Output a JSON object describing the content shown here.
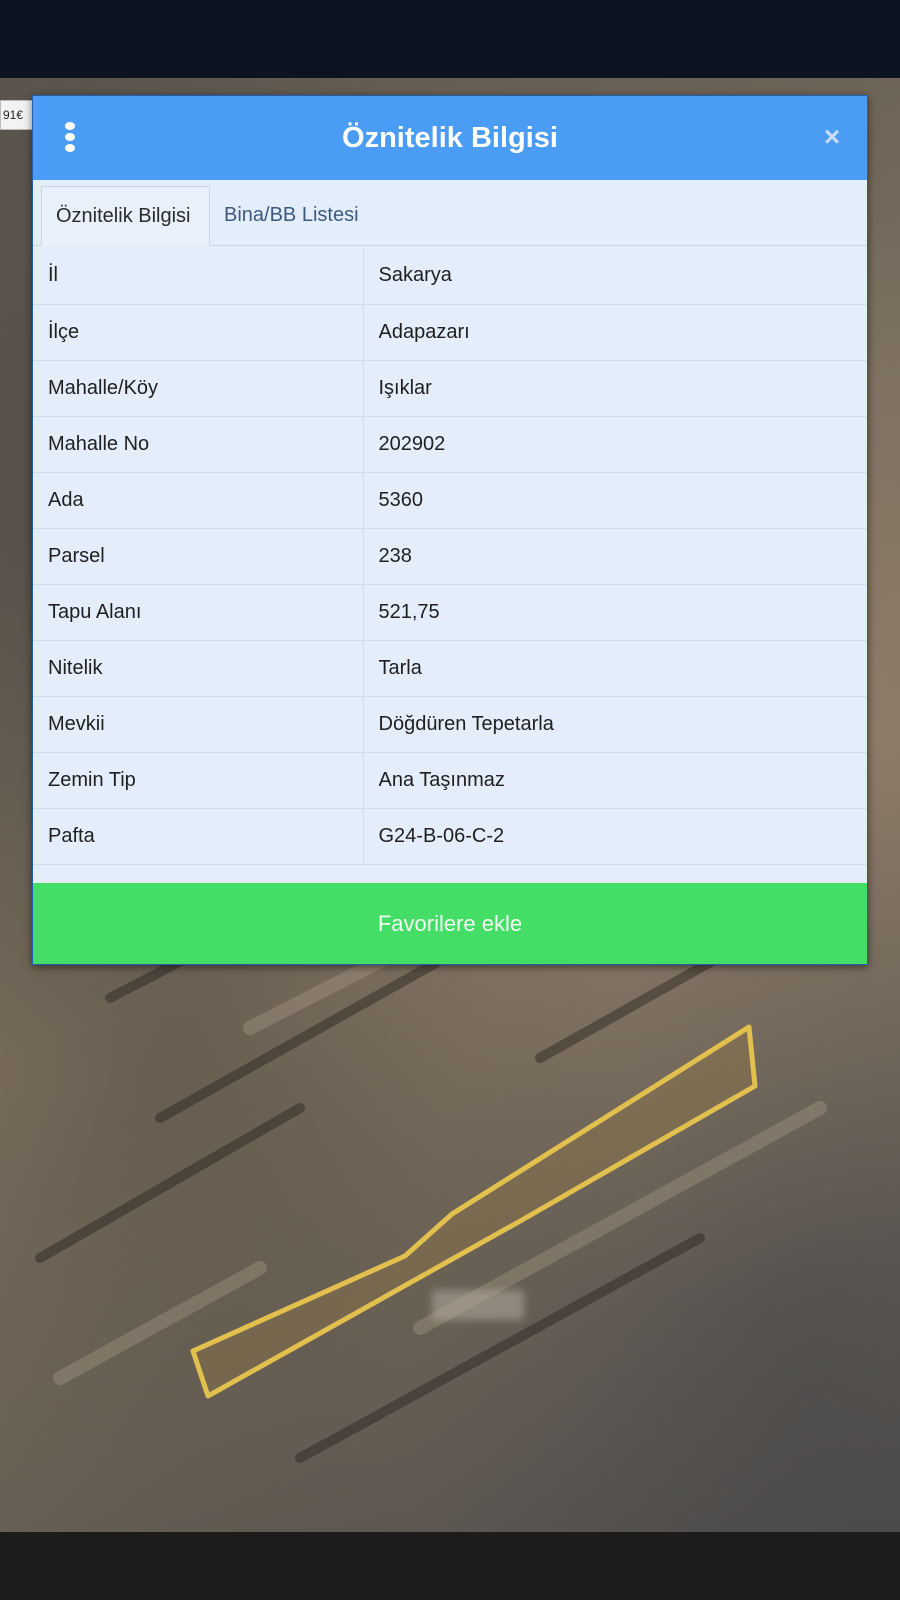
{
  "scale_chip_text": "91€",
  "dialog": {
    "title": "Öznitelik Bilgisi",
    "tabs": [
      {
        "label": "Öznitelik Bilgisi",
        "active": true
      },
      {
        "label": "Bina/BB Listesi",
        "active": false
      }
    ],
    "rows": [
      {
        "key": "İl",
        "value": "Sakarya"
      },
      {
        "key": "İlçe",
        "value": "Adapazarı"
      },
      {
        "key": "Mahalle/Köy",
        "value": "Işıklar"
      },
      {
        "key": "Mahalle No",
        "value": "202902"
      },
      {
        "key": "Ada",
        "value": "5360"
      },
      {
        "key": "Parsel",
        "value": "238"
      },
      {
        "key": "Tapu Alanı",
        "value": "521,75"
      },
      {
        "key": "Nitelik",
        "value": "Tarla"
      },
      {
        "key": "Mevkii",
        "value": "Döğdüren Tepetarla"
      },
      {
        "key": "Zemin Tip",
        "value": "Ana Taşınmaz"
      },
      {
        "key": "Pafta",
        "value": "G24-B-06-C-2"
      }
    ],
    "favorite_button_label": "Favorilere ekle"
  },
  "colors": {
    "header": "#4a9cf4",
    "favorite_button": "#44dd66",
    "parcel_outline": "#e2c04e"
  },
  "icons": [
    "kebab-menu-icon",
    "close-icon"
  ]
}
